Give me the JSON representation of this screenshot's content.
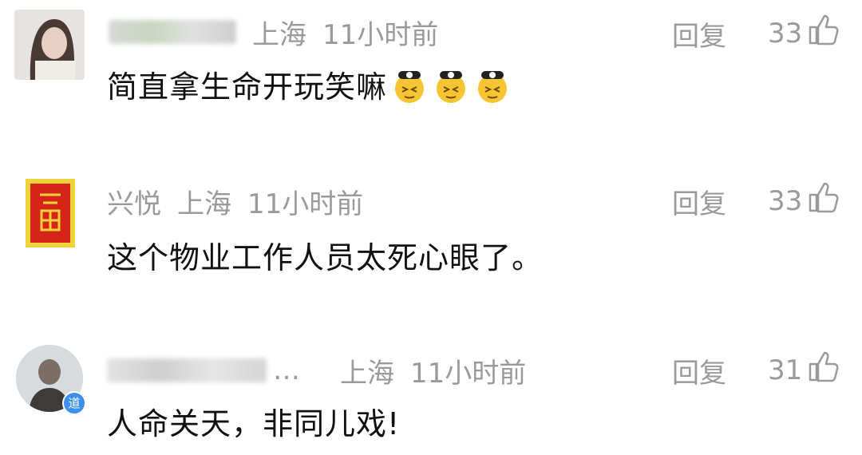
{
  "comments": [
    {
      "username": "",
      "location": "上海",
      "time": "11小时前",
      "text": "简直拿生命开玩笑嘛",
      "emoji": "squinting-face-emoji",
      "emoji_count": 3,
      "reply_label": "回复",
      "likes": "33"
    },
    {
      "username": "兴悦",
      "location": "上海",
      "time": "11小时前",
      "text": "这个物业工作人员太死心眼了。",
      "reply_label": "回复",
      "likes": "33"
    },
    {
      "username": "…",
      "location": "上海",
      "time": "11小时前",
      "text": "人命关天，非同儿戏!",
      "badge": "道",
      "reply_label": "回复",
      "likes": "31"
    }
  ],
  "colors": {
    "meta_text": "#9a9a9a",
    "body_text": "#111111",
    "badge_bg": "#3d8ff0"
  }
}
